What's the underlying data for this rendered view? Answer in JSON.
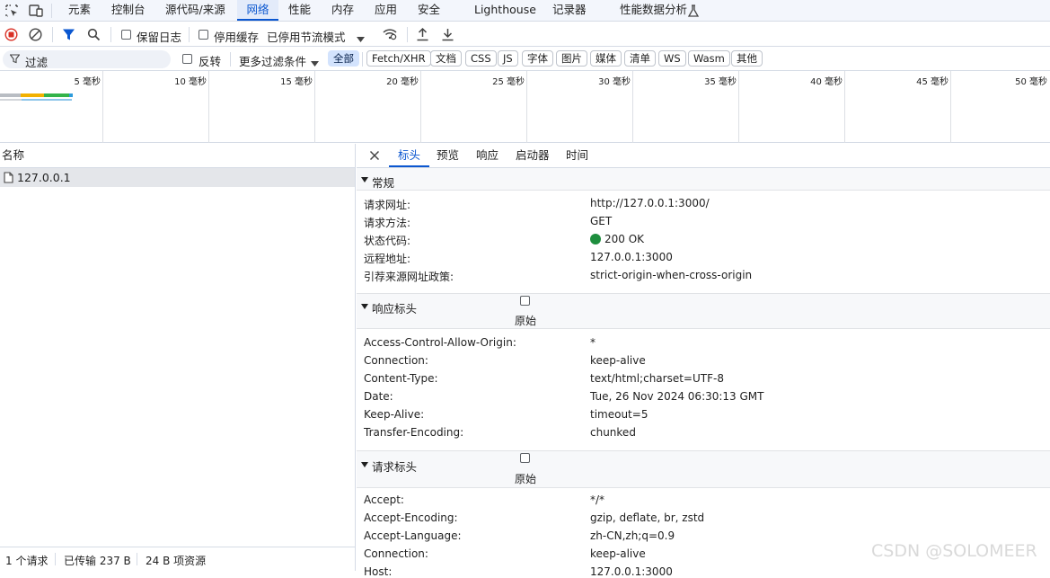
{
  "tabs": [
    "元素",
    "控制台",
    "源代码/来源",
    "网络",
    "性能",
    "内存",
    "应用",
    "安全",
    "Lighthouse",
    "记录器",
    "性能数据分析"
  ],
  "toolbar": {
    "preserve_log": "保留日志",
    "disable_cache": "停用缓存",
    "throttling": "已停用节流模式"
  },
  "filter": {
    "placeholder": "过滤",
    "invert": "反转",
    "more_filters": "更多过滤条件",
    "types": [
      "全部",
      "Fetch/XHR",
      "文档",
      "CSS",
      "JS",
      "字体",
      "图片",
      "媒体",
      "清单",
      "WS",
      "Wasm",
      "其他"
    ]
  },
  "overview": {
    "ticks": [
      "5 毫秒",
      "10 毫秒",
      "15 毫秒",
      "20 毫秒",
      "25 毫秒",
      "30 毫秒",
      "35 毫秒",
      "40 毫秒",
      "45 毫秒",
      "50 毫秒"
    ],
    "colors": [
      "#b9bdc3",
      "#f2b100",
      "#2d9bdb",
      "#33b34a"
    ]
  },
  "requests": {
    "column_name": "名称",
    "items": [
      {
        "name": "127.0.0.1"
      }
    ]
  },
  "status_bar": {
    "count": "1 个请求",
    "transferred": "已传输 237 B",
    "resources": "24 B 项资源"
  },
  "detail": {
    "tabs": [
      "标头",
      "预览",
      "响应",
      "启动器",
      "时间"
    ],
    "general": {
      "title": "常规",
      "rows": [
        {
          "key": "请求网址:",
          "value": "http://127.0.0.1:3000/"
        },
        {
          "key": "请求方法:",
          "value": "GET"
        },
        {
          "key": "状态代码:",
          "value": "200 OK"
        },
        {
          "key": "远程地址:",
          "value": "127.0.0.1:3000"
        },
        {
          "key": "引荐来源网址政策:",
          "value": "strict-origin-when-cross-origin"
        }
      ]
    },
    "response_headers": {
      "title": "响应标头",
      "raw_label": "原始",
      "rows": [
        {
          "key": "Access-Control-Allow-Origin:",
          "value": "*"
        },
        {
          "key": "Connection:",
          "value": "keep-alive"
        },
        {
          "key": "Content-Type:",
          "value": "text/html;charset=UTF-8"
        },
        {
          "key": "Date:",
          "value": "Tue, 26 Nov 2024 06:30:13 GMT"
        },
        {
          "key": "Keep-Alive:",
          "value": "timeout=5"
        },
        {
          "key": "Transfer-Encoding:",
          "value": "chunked"
        }
      ]
    },
    "request_headers": {
      "title": "请求标头",
      "raw_label": "原始",
      "rows": [
        {
          "key": "Accept:",
          "value": "*/*"
        },
        {
          "key": "Accept-Encoding:",
          "value": "gzip, deflate, br, zstd"
        },
        {
          "key": "Accept-Language:",
          "value": "zh-CN,zh;q=0.9"
        },
        {
          "key": "Connection:",
          "value": "keep-alive"
        },
        {
          "key": "Host:",
          "value": "127.0.0.1:3000"
        }
      ]
    }
  },
  "watermark": "CSDN @SOLOMEER",
  "colors": {
    "accent": "#0b57d0",
    "record": "#d93025",
    "status_ok": "#1e8e3e"
  }
}
